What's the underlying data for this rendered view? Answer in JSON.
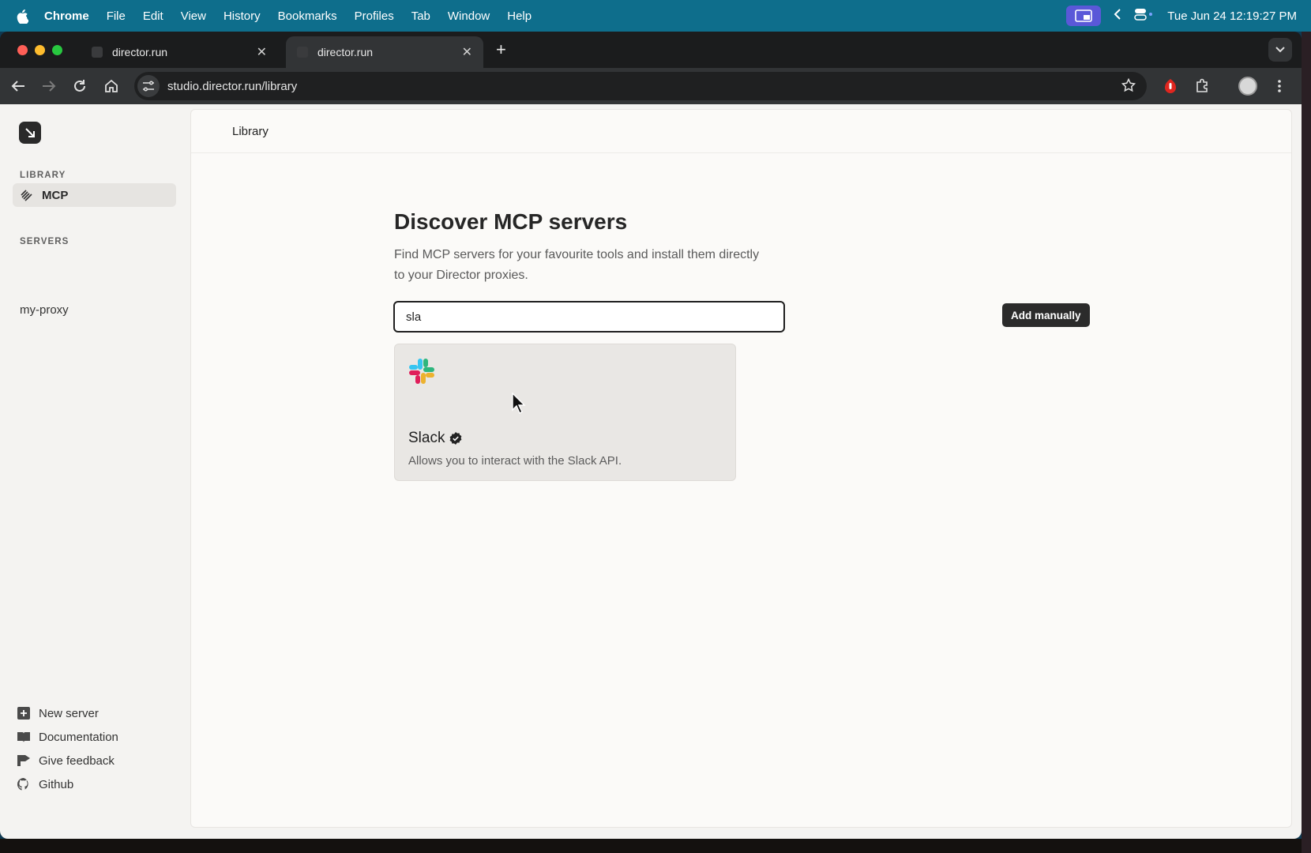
{
  "menubar": {
    "app": "Chrome",
    "items": [
      "File",
      "Edit",
      "View",
      "History",
      "Bookmarks",
      "Profiles",
      "Tab",
      "Window",
      "Help"
    ],
    "clock": "Tue Jun 24  12:19:27 PM"
  },
  "browser": {
    "tabs": [
      {
        "label": "director.run",
        "active": false
      },
      {
        "label": "director.run",
        "active": true
      }
    ],
    "url": "studio.director.run/library"
  },
  "sidebar": {
    "library_label": "LIBRARY",
    "library_items": [
      {
        "label": "MCP",
        "icon": "layers-icon",
        "active": true
      }
    ],
    "servers_label": "SERVERS",
    "servers": [
      "my-proxy"
    ],
    "footer": [
      {
        "label": "New server",
        "icon": "plus-square-icon"
      },
      {
        "label": "Documentation",
        "icon": "book-icon"
      },
      {
        "label": "Give feedback",
        "icon": "feedback-icon"
      },
      {
        "label": "Github",
        "icon": "github-icon"
      }
    ]
  },
  "main": {
    "breadcrumb": "Library",
    "title": "Discover MCP servers",
    "description": "Find MCP servers for your favourite tools and install them directly to your Director proxies.",
    "search_value": "sla",
    "add_button": "Add manually",
    "results": [
      {
        "name": "Slack",
        "verified": true,
        "description": "Allows you to interact with the Slack API.",
        "icon": "slack-logo"
      }
    ]
  },
  "colors": {
    "menubar": "#0e6e8c",
    "page_bg": "#f4f3f1",
    "accent_dark": "#2b2b2b",
    "card_bg": "#e9e7e4"
  }
}
